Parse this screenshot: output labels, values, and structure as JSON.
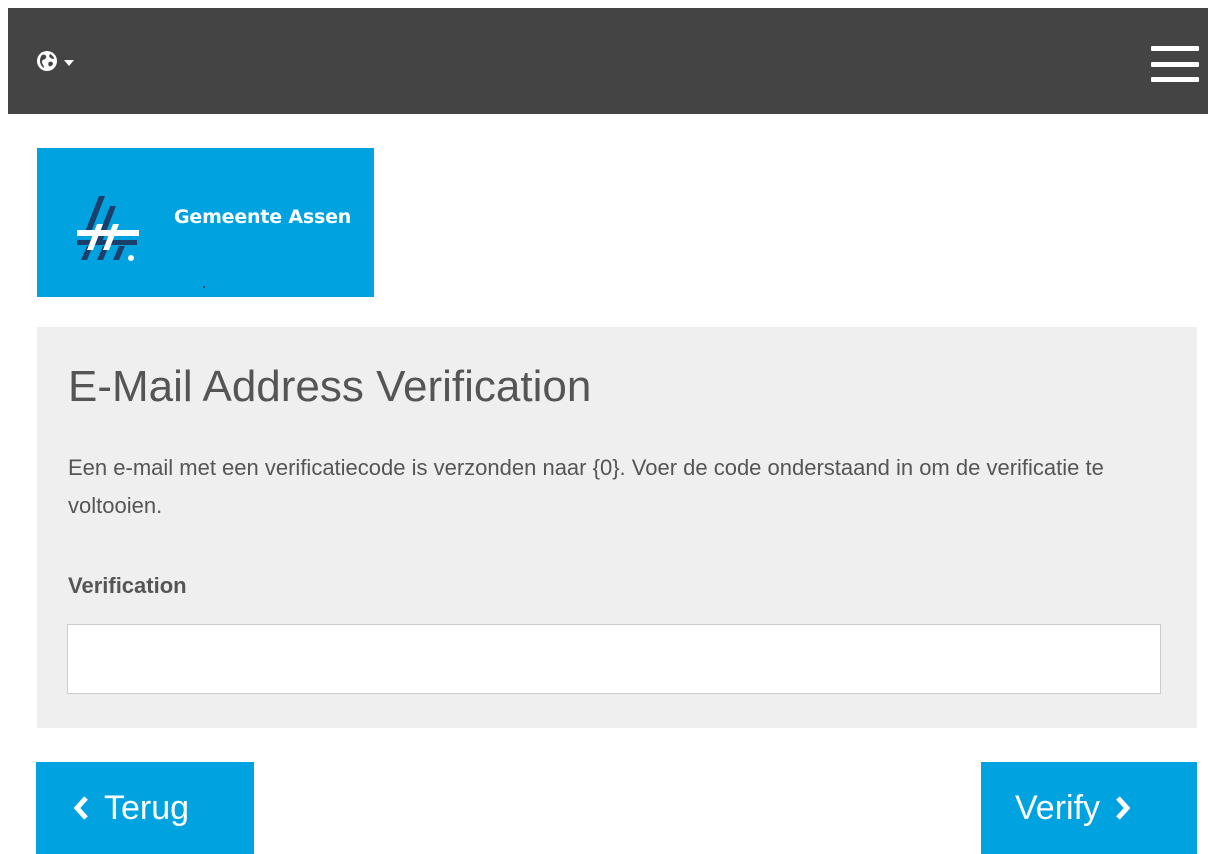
{
  "header": {
    "language_icon": "globe-icon",
    "caret_icon": "caret-down-icon",
    "menu_icon": "hamburger-menu-icon"
  },
  "logo": {
    "text": "Gemeente Assen",
    "background": "#00a3e0"
  },
  "panel": {
    "title": "E-Mail Address Verification",
    "description": "Een e-mail met een verificatiecode is verzonden naar {0}. Voer de code onderstaand in om de verificatie te voltooien.",
    "field_label": "Verification",
    "field_value": "",
    "field_placeholder": ""
  },
  "buttons": {
    "back_label": "Terug",
    "back_icon": "chevron-left-icon",
    "verify_label": "Verify",
    "verify_icon": "chevron-right-icon"
  },
  "colors": {
    "header_bg": "#444444",
    "accent": "#00a3e0",
    "panel_bg": "#efefef",
    "text": "#555555"
  }
}
